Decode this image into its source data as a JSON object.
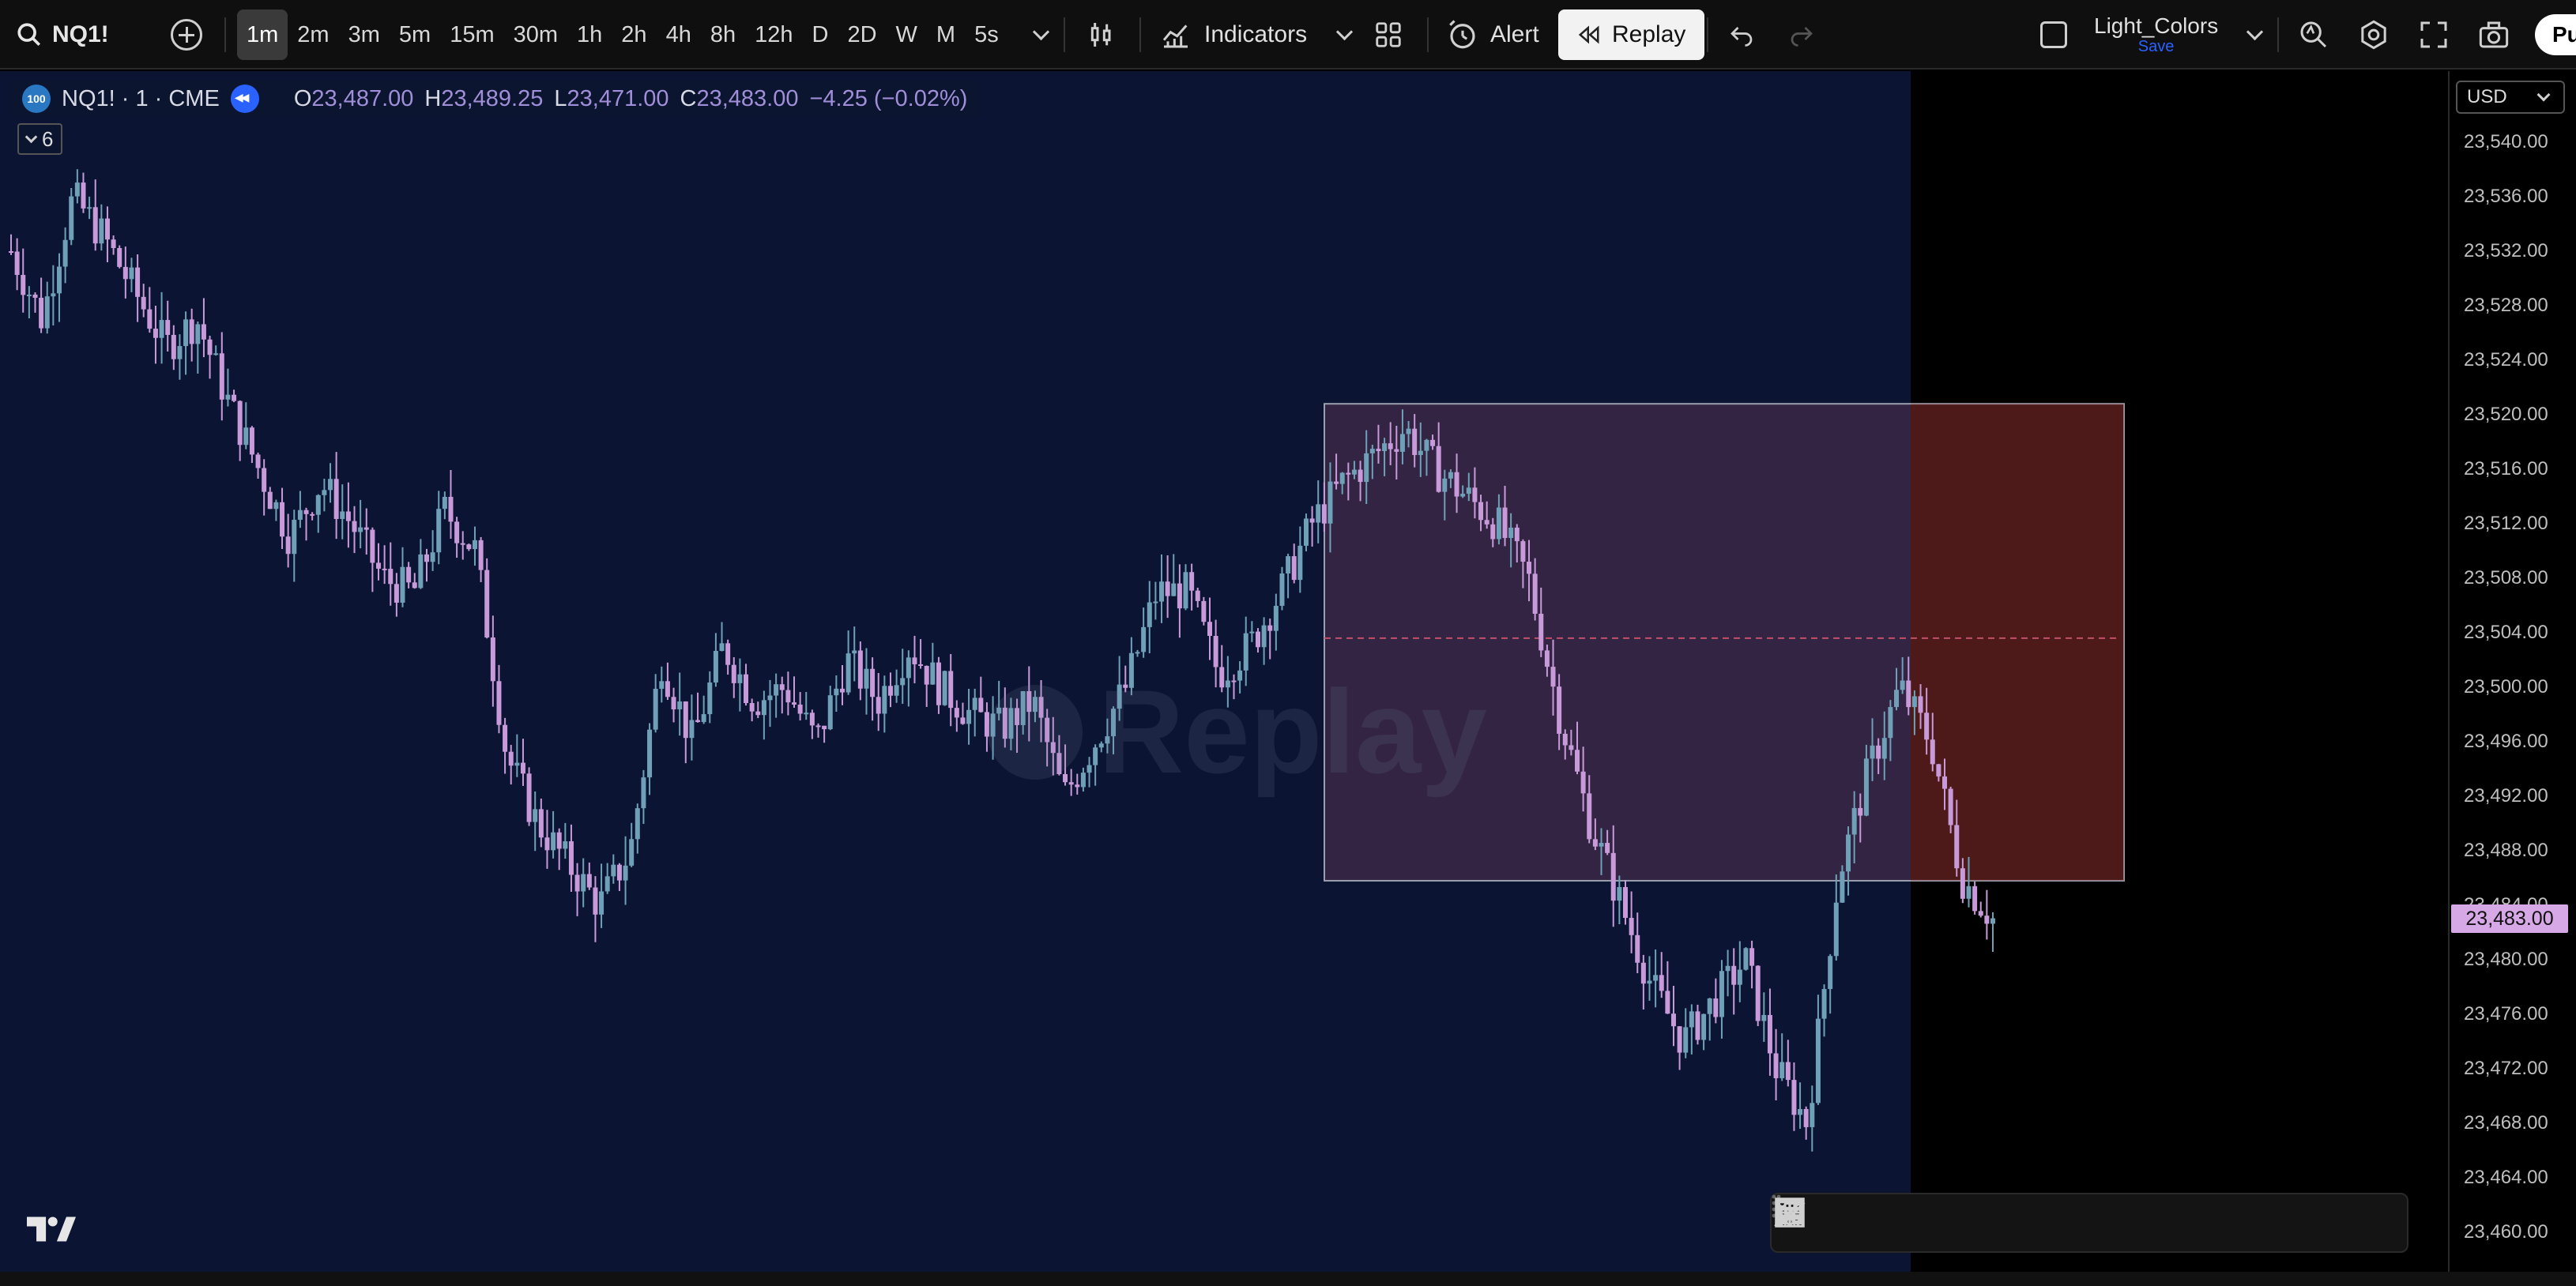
{
  "toolbar": {
    "symbol": "NQ1!",
    "intervals": [
      "1m",
      "2m",
      "3m",
      "5m",
      "15m",
      "30m",
      "1h",
      "2h",
      "4h",
      "8h",
      "12h",
      "D",
      "2D",
      "W",
      "M",
      "5s"
    ],
    "active_interval": "1m",
    "indicators_label": "Indicators",
    "alert_label": "Alert",
    "replay_label": "Replay",
    "layout_name": "Light_Colors",
    "layout_save": "Save",
    "publish_label": "Pu"
  },
  "legend": {
    "badge": "100",
    "title": "NQ1! · 1 · CME",
    "o_key": "O",
    "o_val": "23,487.00",
    "h_key": "H",
    "h_val": "23,489.25",
    "l_key": "L",
    "l_val": "23,471.00",
    "c_key": "C",
    "c_val": "23,483.00",
    "change": "−4.25 (−0.02%)",
    "collapse_count": "6"
  },
  "watermark": "Replay",
  "price_axis": {
    "currency": "USD",
    "ticks": [
      "23,540.00",
      "23,536.00",
      "23,532.00",
      "23,528.00",
      "23,524.00",
      "23,520.00",
      "23,516.00",
      "23,512.00",
      "23,508.00",
      "23,504.00",
      "23,500.00",
      "23,496.00",
      "23,492.00",
      "23,488.00",
      "23,484.00",
      "23,480.00",
      "23,476.00",
      "23,472.00",
      "23,468.00",
      "23,464.00",
      "23,460.00"
    ],
    "last_price": "23,483.00"
  },
  "chart_data": {
    "type": "candlestick",
    "symbol": "NQ1!",
    "exchange": "CME",
    "timeframe": "1m",
    "ylim": [
      23458,
      23542
    ],
    "last_price": 23483.0,
    "box": {
      "price_top": 23520.8,
      "price_bottom": 23485.8
    },
    "dashed_line_price": 23503.6,
    "close_path": [
      23532,
      23527,
      23536,
      23533,
      23529,
      23525,
      23527,
      23521,
      23516,
      23511,
      23515,
      23512,
      23508,
      23507,
      23513,
      23510,
      23495,
      23490,
      23487,
      23484,
      23488,
      23502,
      23496,
      23503,
      23499,
      23500,
      23496,
      23502,
      23499,
      23503,
      23500,
      23498,
      23497,
      23499,
      23492,
      23496,
      23500,
      23507,
      23507,
      23501,
      23503,
      23507,
      23512,
      23515,
      23517,
      23519,
      23516,
      23514,
      23512,
      23508,
      23498,
      23490,
      23484,
      23478,
      23474,
      23477,
      23480,
      23472,
      23468,
      23486,
      23494,
      23500,
      23496,
      23486,
      23483
    ],
    "colors": {
      "up": "#6fa0b8",
      "down": "#c99ad9",
      "replay_zone": "#0b1533",
      "box": "#ff8ca8"
    }
  },
  "drawing_tools": [
    "grip-handle",
    "horizontal-ray-tool",
    "trend-line-tool",
    "parallel-channel-tool",
    "rectangle-tool",
    "fib-retracement-tool",
    "pitchfork-tool",
    "callout-tool",
    "brush-tool",
    "text-tool",
    "grid-tool"
  ]
}
